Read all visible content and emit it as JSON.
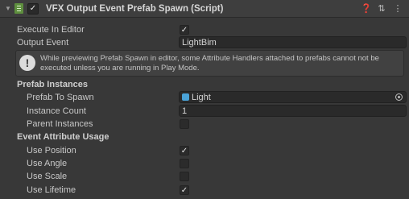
{
  "header": {
    "title": "VFX Output Event Prefab Spawn (Script)",
    "enabled_check": "✓",
    "icons": [
      "help-icon",
      "preset-icon",
      "more-icon"
    ],
    "icon_glyphs": [
      "❓",
      "⇅",
      "⋮"
    ]
  },
  "fields": {
    "execute_in_editor": {
      "label": "Execute In Editor",
      "checked": true,
      "mark": "✓"
    },
    "output_event": {
      "label": "Output Event",
      "value": "LightBim"
    }
  },
  "help": {
    "text": "While previewing Prefab Spawn in editor, some Attribute Handlers attached to prefabs cannot not be executed unless you are running in Play Mode.",
    "icon": "!"
  },
  "prefab_instances": {
    "header": "Prefab Instances",
    "prefab_to_spawn": {
      "label": "Prefab To Spawn",
      "value": "Light"
    },
    "instance_count": {
      "label": "Instance Count",
      "value": "1"
    },
    "parent_instances": {
      "label": "Parent Instances",
      "checked": false
    }
  },
  "event_attribute_usage": {
    "header": "Event Attribute Usage",
    "use_position": {
      "label": "Use Position",
      "checked": true,
      "mark": "✓"
    },
    "use_angle": {
      "label": "Use Angle",
      "checked": false
    },
    "use_scale": {
      "label": "Use Scale",
      "checked": false
    },
    "use_lifetime": {
      "label": "Use Lifetime",
      "checked": true,
      "mark": "✓"
    }
  }
}
